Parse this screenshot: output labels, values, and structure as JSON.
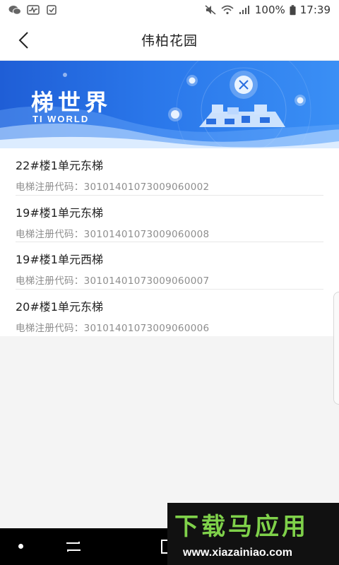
{
  "status_bar": {
    "battery": "100%",
    "time": "17:39"
  },
  "header": {
    "title": "伟柏花园"
  },
  "banner": {
    "title": "梯世界",
    "subtitle": "TI WORLD"
  },
  "elevators": [
    {
      "name": "22#楼1单元东梯",
      "code_label": "电梯注册代码：30101401073009060002"
    },
    {
      "name": "19#楼1单元东梯",
      "code_label": "电梯注册代码：30101401073009060008"
    },
    {
      "name": "19#楼1单元西梯",
      "code_label": "电梯注册代码：30101401073009060007"
    },
    {
      "name": "20#楼1单元东梯",
      "code_label": "电梯注册代码：30101401073009060006"
    }
  ],
  "watermark": {
    "brand": "下载马应用",
    "url": "www.xiazainiao.com"
  },
  "colors": {
    "banner_start": "#1f5ed6",
    "banner_end": "#3a8ff5",
    "watermark_green": "#7fd14a"
  }
}
